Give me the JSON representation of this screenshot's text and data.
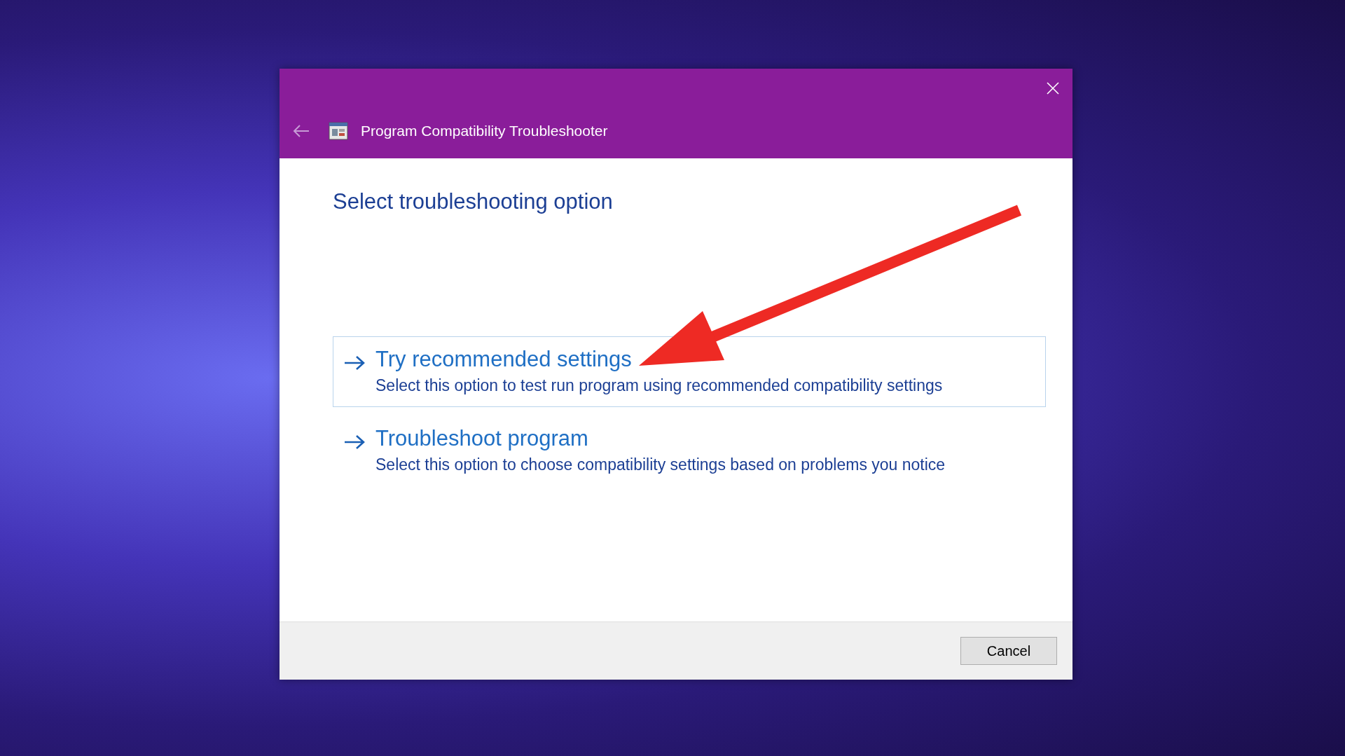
{
  "window": {
    "title": "Program Compatibility Troubleshooter"
  },
  "heading": "Select troubleshooting option",
  "options": [
    {
      "title": "Try recommended settings",
      "description": "Select this option to test run program using recommended compatibility settings",
      "selected": true
    },
    {
      "title": "Troubleshoot program",
      "description": "Select this option to choose compatibility settings based on problems you notice",
      "selected": false
    }
  ],
  "buttons": [
    {
      "label": "Cancel"
    }
  ]
}
